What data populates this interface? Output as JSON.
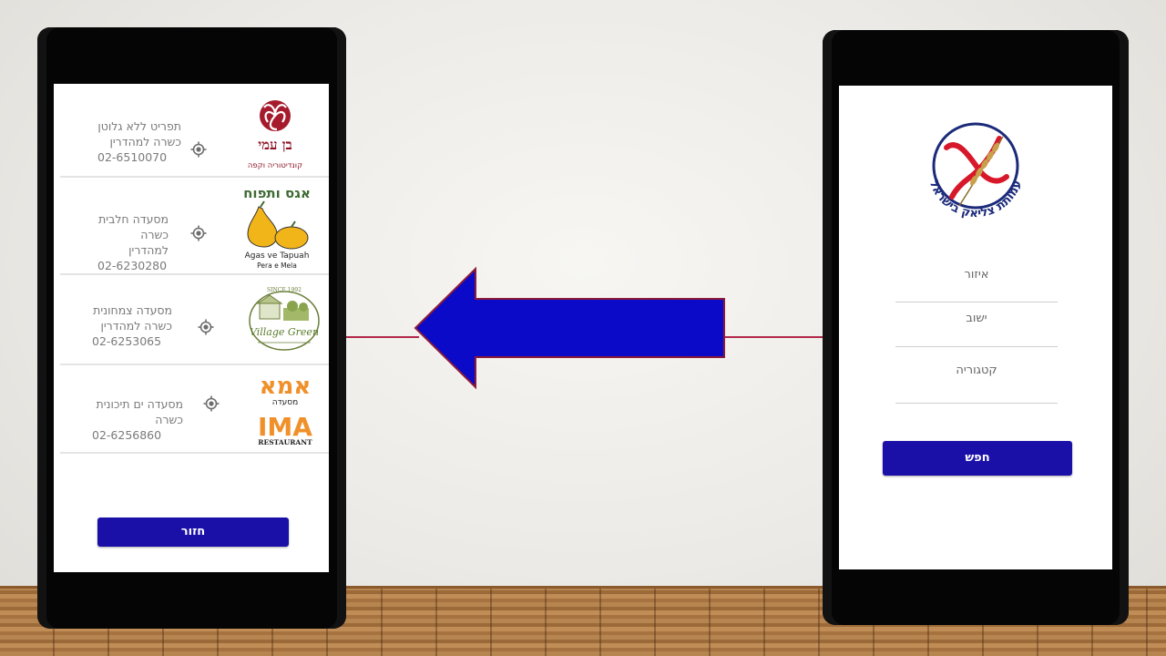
{
  "results_screen": {
    "items": [
      {
        "logo_name": "בן עמי",
        "logo_sub": "קונדיטוריה וקפה",
        "category": "תפריט ללא גלוטן",
        "kashrut": "כשרה למהדרין",
        "phone": "02-6510070"
      },
      {
        "logo_name": "אגס ותפוח",
        "logo_sub": "Agas ve Tapuah",
        "logo_sub2": "Pera e Mela",
        "category": "מסעדה חלבית",
        "kashrut": "כשרה למהדרין",
        "phone": "02-6230280"
      },
      {
        "logo_name": "Village Green",
        "logo_top": "SINCE 1992",
        "category": "מסעדה צמחונית",
        "kashrut": "כשרה למהדרין",
        "phone": "02-6253065"
      },
      {
        "logo_name": "אמא",
        "logo_sub": "מסעדה",
        "logo_latin": "IMA",
        "logo_latin_sub": "RESTAURANT",
        "category": "מסעדה ים תיכונית",
        "kashrut": "כשרה",
        "phone": "02-6256860"
      }
    ],
    "back_button": "חזור"
  },
  "search_screen": {
    "logo_ring_text": "עמותת צליאק בישראל",
    "fields": [
      {
        "label": "איזור"
      },
      {
        "label": "ישוב"
      },
      {
        "label": "קטגוריה"
      }
    ],
    "search_button": "חפש"
  },
  "colors": {
    "button": "#1a10a8",
    "arrow_fill": "#0a0ac8",
    "arrow_stroke": "#8b1a3a",
    "connector": "#b2274a",
    "logo_red": "#d7182a",
    "logo_navy": "#1b2a7a"
  }
}
